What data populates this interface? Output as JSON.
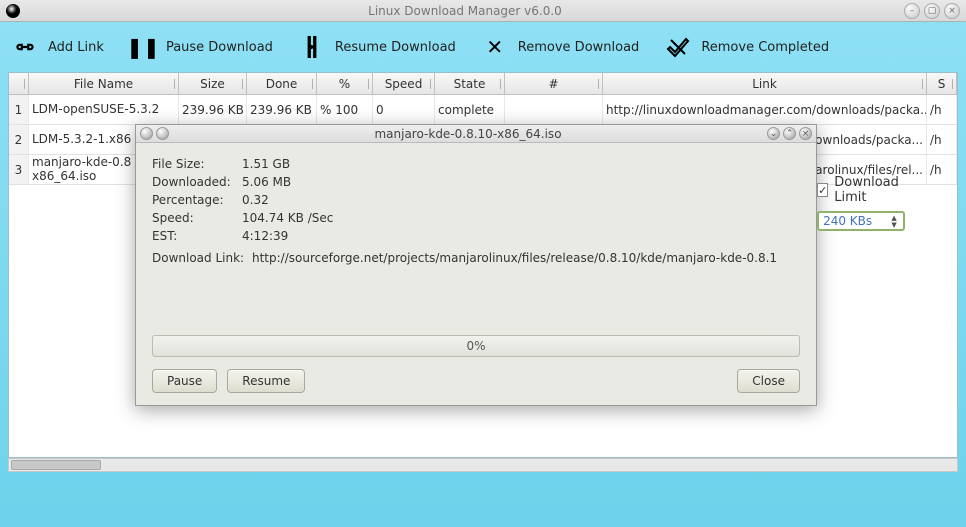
{
  "main_window": {
    "title": "Linux Download Manager v6.0.0"
  },
  "toolbar": {
    "add_link": "Add Link",
    "pause": "Pause Download",
    "resume": "Resume Download",
    "remove": "Remove Download",
    "remove_completed": "Remove Completed"
  },
  "columns": {
    "filename": "File Name",
    "size": "Size",
    "done": "Done",
    "percent": "%",
    "speed": "Speed",
    "state": "State",
    "num": "#",
    "link": "Link",
    "s": "S"
  },
  "rows": [
    {
      "idx": "1",
      "filename": "LDM-openSUSE-5.3.2",
      "size": "239.96 KB",
      "done": "239.96 KB",
      "percent": "% 100",
      "speed": "0",
      "state": "complete",
      "num": "",
      "link": "http://linuxdownloadmanager.com/downloads/packa...",
      "s": "/h"
    },
    {
      "idx": "2",
      "filename": "LDM-5.3.2-1.x86",
      "size": "",
      "done": "",
      "percent": "",
      "speed": "",
      "state": "",
      "num": "",
      "link": "downloads/packa...",
      "s": "/h"
    },
    {
      "idx": "3",
      "filename": "manjaro-kde-0.8 x86_64.iso",
      "size": "",
      "done": "",
      "percent": "",
      "speed": "",
      "state": "",
      "num": "",
      "link": "njarolinux/files/rel...",
      "s": "/h"
    }
  ],
  "dialog": {
    "title": "manjaro-kde-0.8.10-x86_64.iso",
    "labels": {
      "file_size": "File Size:",
      "downloaded": "Downloaded:",
      "percentage": "Percentage:",
      "speed": "Speed:",
      "est": "EST:",
      "download_link": "Download Link:",
      "download_limit": "Download Limit"
    },
    "values": {
      "file_size": "1.51 GB",
      "downloaded": "5.06 MB",
      "percentage": "0.32",
      "speed": "104.74 KB /Sec",
      "est": "4:12:39",
      "download_link": "http://sourceforge.net/projects/manjarolinux/files/release/0.8.10/kde/manjaro-kde-0.8.1",
      "limit_value": "240 KBs"
    },
    "progress_text": "0%",
    "buttons": {
      "pause": "Pause",
      "resume": "Resume",
      "close": "Close"
    }
  }
}
